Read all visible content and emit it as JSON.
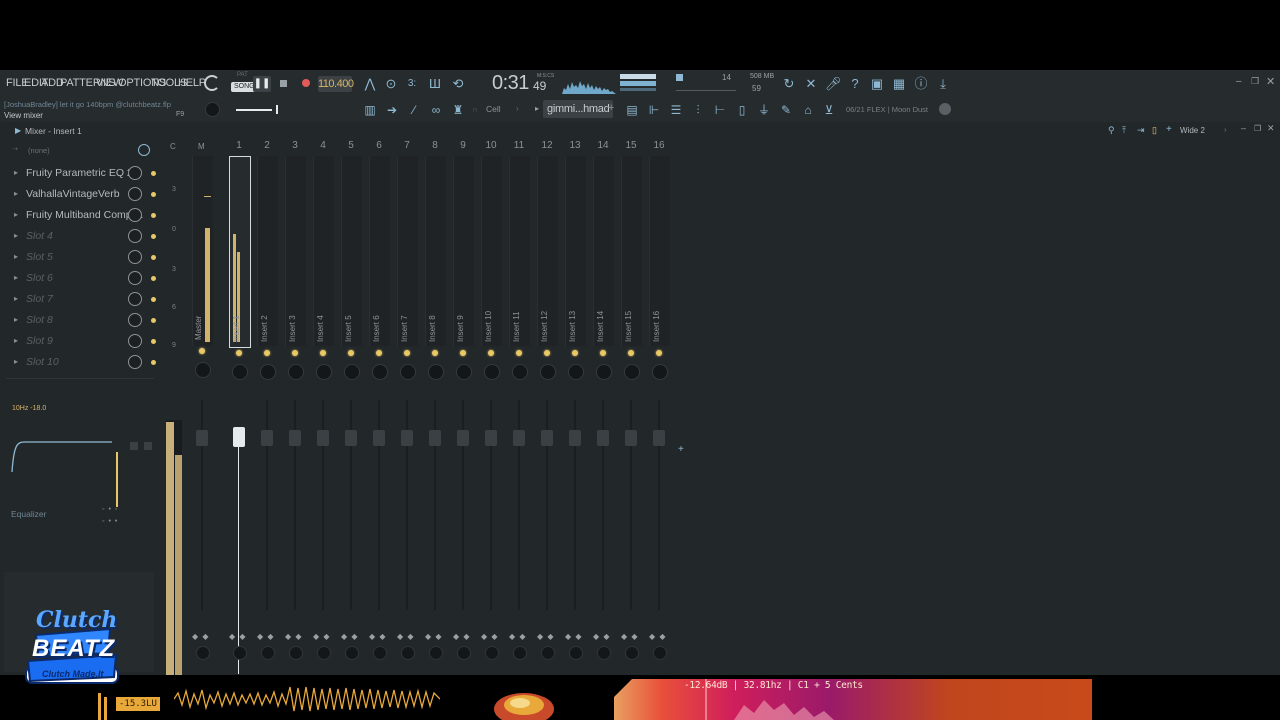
{
  "menu": [
    "FILE",
    "EDIT",
    "ADD",
    "PATTERNS",
    "VIEW",
    "OPTIONS",
    "TOOLS",
    "HELP"
  ],
  "transport": {
    "mode_top": "PAT",
    "mode": "SONG",
    "tempo": "110.400",
    "time_main": "0:31",
    "time_sub": "49",
    "time_unit": "M:S:CS"
  },
  "meters": {
    "cpu_count": "14",
    "memory": "508 MB",
    "polyphony": "59"
  },
  "hint": {
    "line1": "[JoshuaBradley] let it go 140bpm @clutchbeatz.flp",
    "shortcut": "F9",
    "line2": "View mixer"
  },
  "toolbar2": {
    "snap": "Cell",
    "pattern": "gimmi...hmad",
    "plugin_browser": "06/21  FLEX | Moon Dust"
  },
  "mixer": {
    "title": "Mixer - Insert 1",
    "input": "(none)",
    "layout": "Wide 2",
    "header_c": "C",
    "header_m": "M",
    "slots": [
      {
        "label": "Fruity Parametric EQ 2",
        "empty": false
      },
      {
        "label": "ValhallaVintageVerb",
        "empty": false
      },
      {
        "label": "Fruity Multiband Compr...",
        "empty": false
      },
      {
        "label": "Slot 4",
        "empty": true
      },
      {
        "label": "Slot 5",
        "empty": true
      },
      {
        "label": "Slot 6",
        "empty": true
      },
      {
        "label": "Slot 7",
        "empty": true
      },
      {
        "label": "Slot 8",
        "empty": true
      },
      {
        "label": "Slot 9",
        "empty": true
      },
      {
        "label": "Slot 10",
        "empty": true
      }
    ],
    "eq_readout": "10Hz  -18.0",
    "eq_label": "Equalizer",
    "master_label": "Master",
    "strips": [
      "Insert 1",
      "Insert 2",
      "Insert 3",
      "Insert 4",
      "Insert 5",
      "Insert 6",
      "Insert 7",
      "Insert 8",
      "Insert 9",
      "Insert 10",
      "Insert 11",
      "Insert 12",
      "Insert 13",
      "Insert 14",
      "Insert 15",
      "Insert 16"
    ],
    "strip_numbers": [
      "1",
      "2",
      "3",
      "4",
      "5",
      "6",
      "7",
      "8",
      "9",
      "10",
      "11",
      "12",
      "13",
      "14",
      "15",
      "16"
    ],
    "db_scale": [
      "3",
      "0",
      "3",
      "6",
      "9"
    ]
  },
  "overlay": {
    "lufs": "-15.3LU",
    "analyzer": "-12.64dB | 32.81hz | C1 + 5 Cents",
    "logo_line1": "Clutch",
    "logo_line2": "BEATZ",
    "logo_tagline": "Clutch Made.It"
  },
  "colors": {
    "accent": "#e8c766",
    "icon": "#8fb9d2",
    "panel": "#22272a",
    "record": "#e35a5a"
  }
}
